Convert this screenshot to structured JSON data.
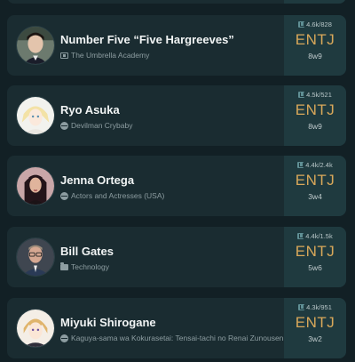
{
  "profiles": [
    {
      "name": "Number Five “Five Hargreeves”",
      "source": "The Umbrella Academy",
      "source_icon": "tv-icon",
      "votes": "4.6k/828",
      "mbti": "ENTJ",
      "enneagram": "8w9"
    },
    {
      "name": "Ryo Asuka",
      "source": "Devilman Crybaby",
      "source_icon": "globe-icon",
      "votes": "4.5k/521",
      "mbti": "ENTJ",
      "enneagram": "8w9"
    },
    {
      "name": "Jenna Ortega",
      "source": "Actors and Actresses (USA)",
      "source_icon": "globe-icon",
      "votes": "4.4k/2.4k",
      "mbti": "ENTJ",
      "enneagram": "3w4"
    },
    {
      "name": "Bill Gates",
      "source": "Technology",
      "source_icon": "folder-icon",
      "votes": "4.4k/1.5k",
      "mbti": "ENTJ",
      "enneagram": "5w6"
    },
    {
      "name": "Miyuki Shirogane",
      "source": "Kaguya-sama wa Kokurasetai: Tensai-tachi no Renai Zunousen",
      "source_icon": "globe-icon",
      "votes": "4.3k/951",
      "mbti": "ENTJ",
      "enneagram": "3w2"
    }
  ],
  "colors": {
    "background": "#122025",
    "card": "#1a2c31",
    "type_panel": "#1f3a3f",
    "mbti_accent": "#d9a85a"
  }
}
